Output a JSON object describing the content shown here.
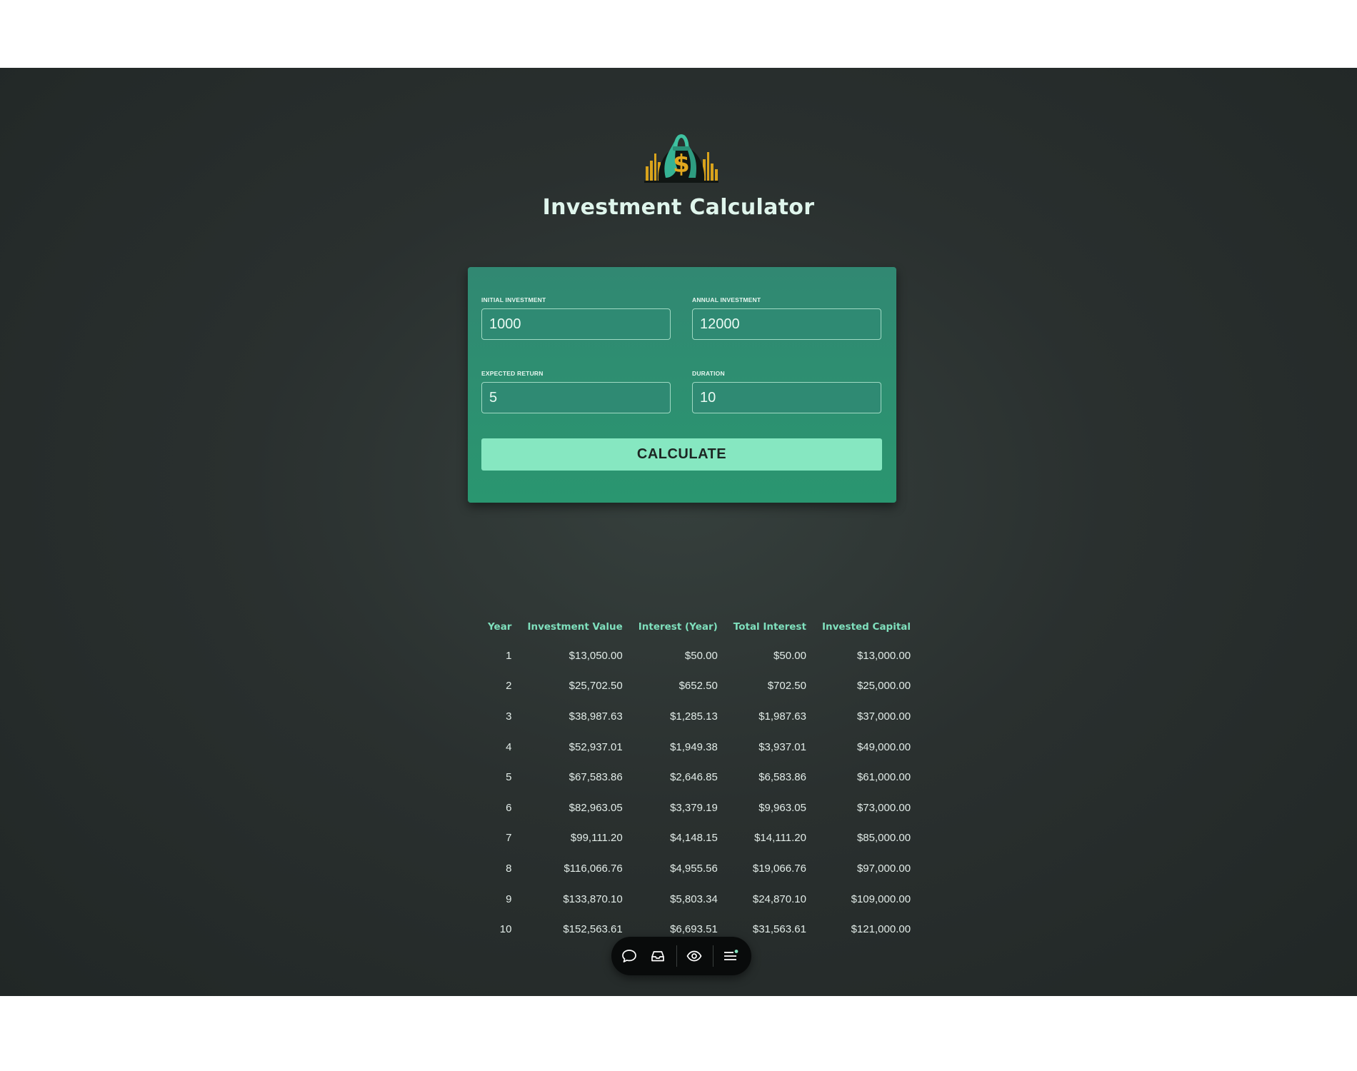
{
  "app": {
    "title": "Investment Calculator"
  },
  "form": {
    "fields": [
      {
        "label": "INITIAL INVESTMENT",
        "value": "1000"
      },
      {
        "label": "ANNUAL INVESTMENT",
        "value": "12000"
      },
      {
        "label": "EXPECTED RETURN",
        "value": "5"
      },
      {
        "label": "DURATION",
        "value": "10"
      }
    ],
    "calculate_label": "CALCULATE"
  },
  "results": {
    "columns": [
      "Year",
      "Investment Value",
      "Interest (Year)",
      "Total Interest",
      "Invested Capital"
    ],
    "rows": [
      [
        "1",
        "$13,050.00",
        "$50.00",
        "$50.00",
        "$13,000.00"
      ],
      [
        "2",
        "$25,702.50",
        "$652.50",
        "$702.50",
        "$25,000.00"
      ],
      [
        "3",
        "$38,987.63",
        "$1,285.13",
        "$1,987.63",
        "$37,000.00"
      ],
      [
        "4",
        "$52,937.01",
        "$1,949.38",
        "$3,937.01",
        "$49,000.00"
      ],
      [
        "5",
        "$67,583.86",
        "$2,646.85",
        "$6,583.86",
        "$61,000.00"
      ],
      [
        "6",
        "$82,963.05",
        "$3,379.19",
        "$9,963.05",
        "$73,000.00"
      ],
      [
        "7",
        "$99,111.20",
        "$4,148.15",
        "$14,111.20",
        "$85,000.00"
      ],
      [
        "8",
        "$116,066.76",
        "$4,955.56",
        "$19,066.76",
        "$97,000.00"
      ],
      [
        "9",
        "$133,870.10",
        "$5,803.34",
        "$24,870.10",
        "$109,000.00"
      ],
      [
        "10",
        "$152,563.61",
        "$6,693.51",
        "$31,563.61",
        "$121,000.00"
      ]
    ]
  },
  "toolbar": {
    "icons": [
      "comment-icon",
      "inbox-icon",
      "eye-icon",
      "menu-icon"
    ]
  },
  "colors": {
    "background": "#2a302f",
    "card": "#2f8a73",
    "accent": "#86e7c1",
    "header_text": "#7fe0bd"
  }
}
